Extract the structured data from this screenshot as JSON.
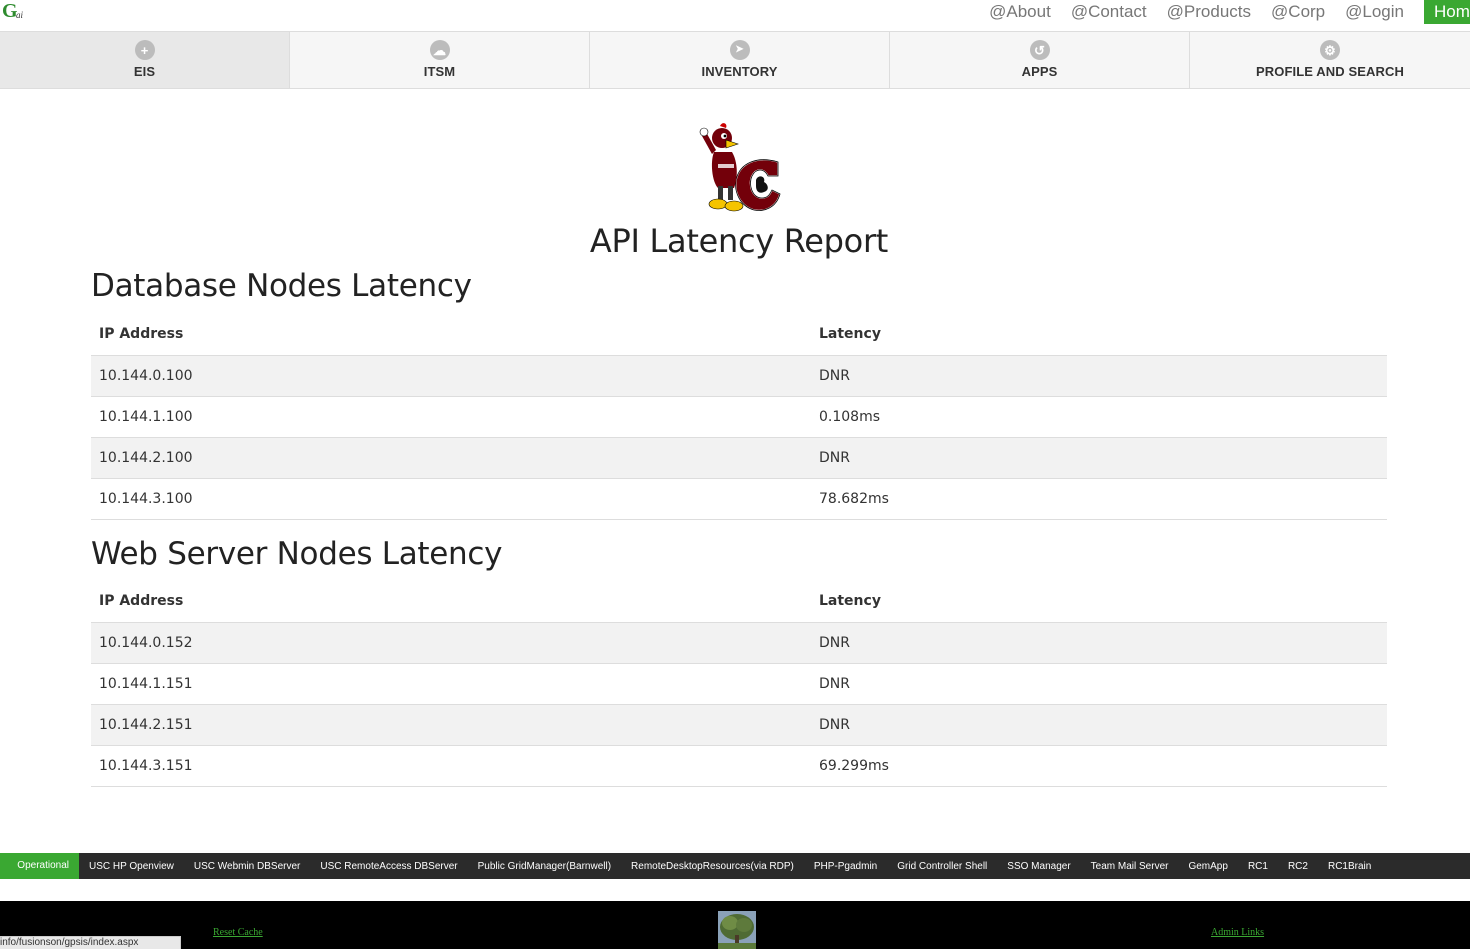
{
  "logo": {
    "text": "G",
    "sub": "ai"
  },
  "toplinks": [
    "@About",
    "@Contact",
    "@Products",
    "@Corp",
    "@Login",
    "Home"
  ],
  "nav": [
    {
      "label": "EIS",
      "icon": "plus-circle-icon",
      "glyph": "+"
    },
    {
      "label": "ITSM",
      "icon": "cloud-icon",
      "glyph": "☁"
    },
    {
      "label": "INVENTORY",
      "icon": "navigation-arrow-icon",
      "glyph": "➤"
    },
    {
      "label": "APPS",
      "icon": "undo-icon",
      "glyph": "↺"
    },
    {
      "label": "PROFILE AND SEARCH",
      "icon": "gear-icon",
      "glyph": "⚙"
    }
  ],
  "page_title": "API Latency Report",
  "database": {
    "heading": "Database Nodes Latency",
    "columns": [
      "IP Address",
      "Latency"
    ],
    "rows": [
      [
        "10.144.0.100",
        "DNR"
      ],
      [
        "10.144.1.100",
        "0.108ms"
      ],
      [
        "10.144.2.100",
        "DNR"
      ],
      [
        "10.144.3.100",
        "78.682ms"
      ]
    ]
  },
  "webserver": {
    "heading": "Web Server Nodes Latency",
    "columns": [
      "IP Address",
      "Latency"
    ],
    "rows": [
      [
        "10.144.0.152",
        "DNR"
      ],
      [
        "10.144.1.151",
        "DNR"
      ],
      [
        "10.144.2.151",
        "DNR"
      ],
      [
        "10.144.3.151",
        "69.299ms"
      ]
    ]
  },
  "operational_links": {
    "label": "Operational Links",
    "links": [
      "USC HP Openview",
      "USC Webmin DBServer",
      "USC RemoteAccess DBServer",
      "Public GridManager(Barnwell)",
      "RemoteDesktopResources(via RDP)",
      "PHP-Pgadmin",
      "Grid Controller Shell",
      "SSO Manager",
      "Team Mail Server",
      "GemApp",
      "RC1",
      "RC2",
      "RC1Brain"
    ]
  },
  "footer": {
    "reset_cache": "Reset Cache",
    "admin_links": "Admin Links"
  },
  "status_url": "info/fusionson/gpsis/index.aspx"
}
